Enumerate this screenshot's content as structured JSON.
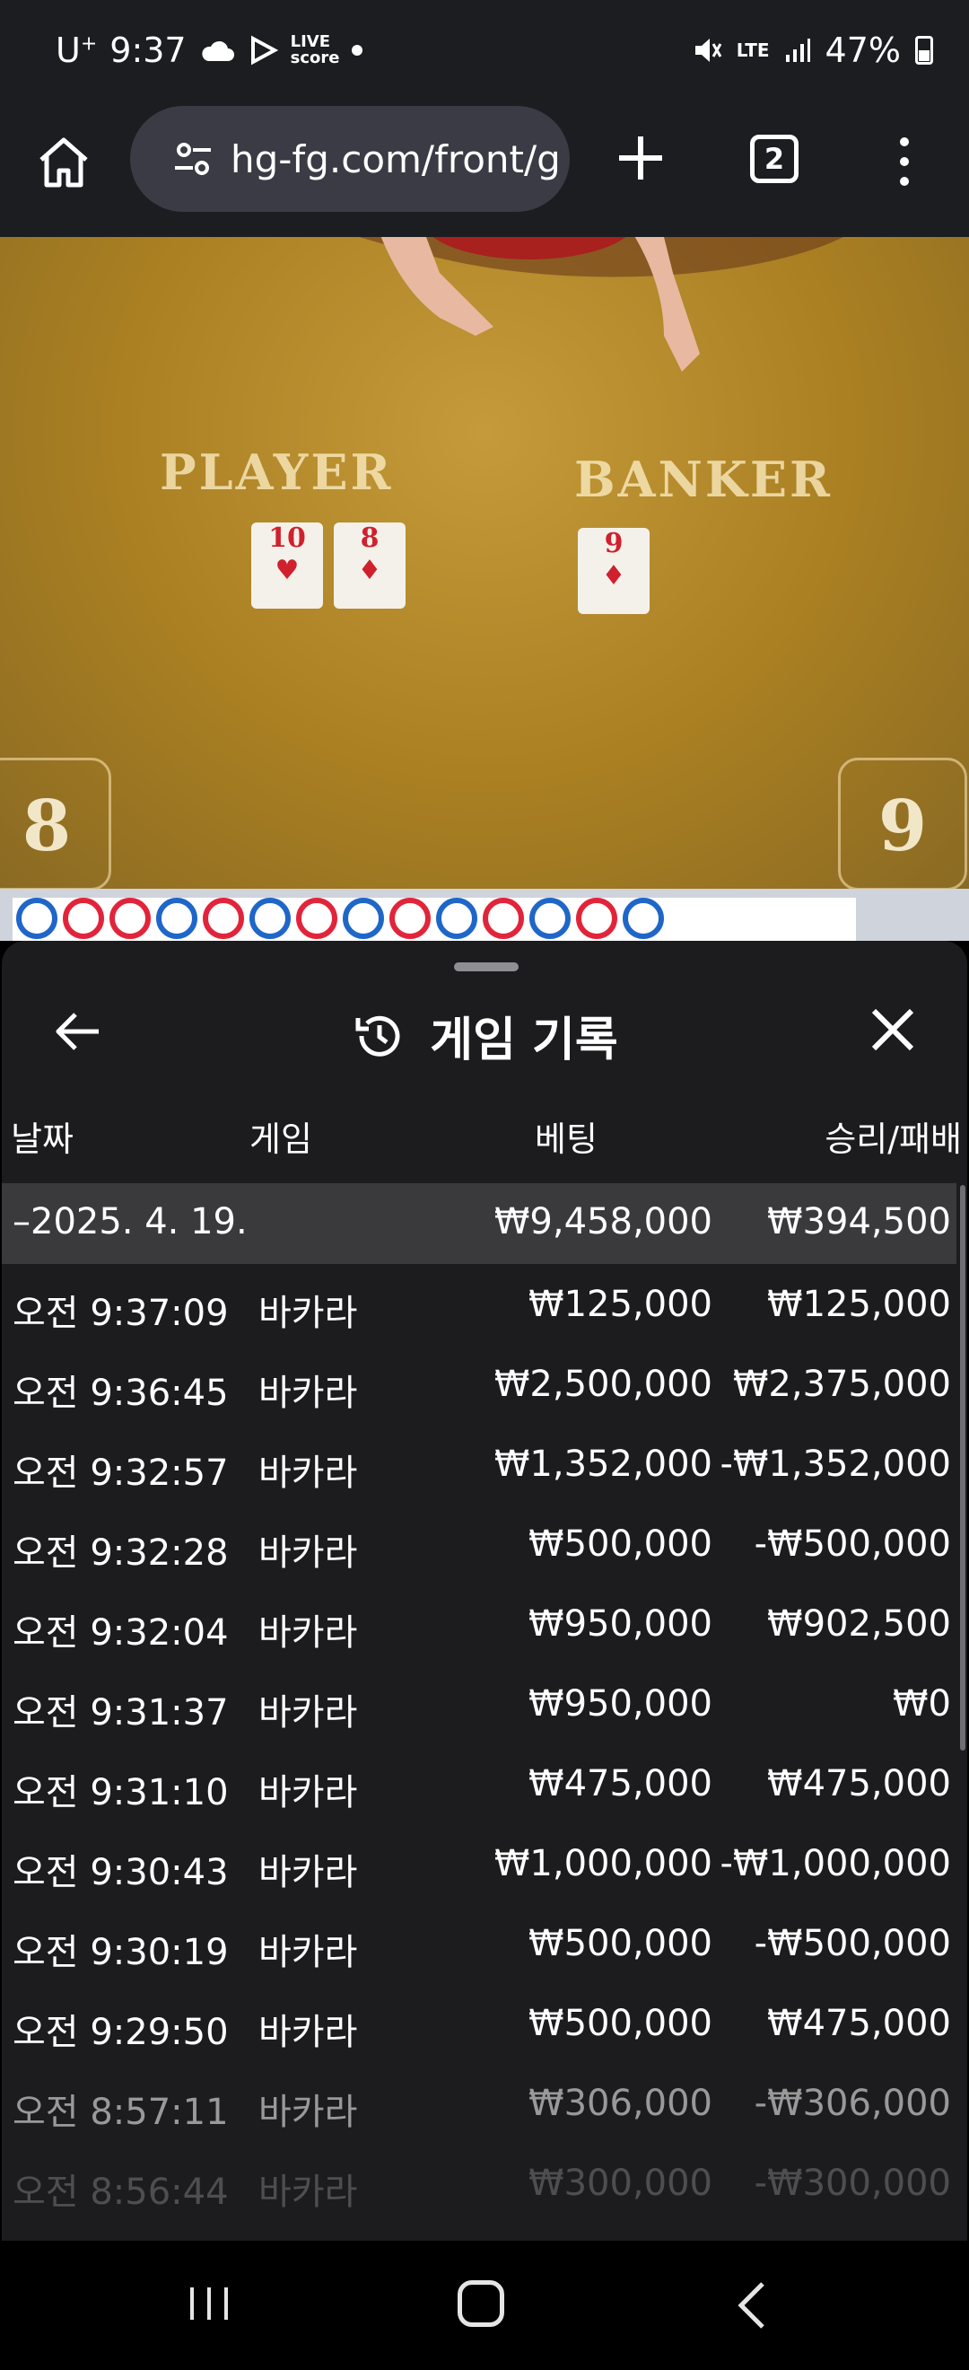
{
  "status_bar": {
    "carrier": "U",
    "carrier_sup": "+",
    "time": "9:37",
    "live_badge_top": "LIVE",
    "live_badge_bottom": "score",
    "network": "LTE",
    "battery": "47%"
  },
  "browser": {
    "url": "hg-fg.com/front/g",
    "tab_count": "2"
  },
  "video": {
    "player_label": "PLAYER",
    "banker_label": "BANKER",
    "player_cards": [
      "10",
      "8"
    ],
    "banker_cards": [
      "9"
    ],
    "player_score": "8",
    "banker_score": "9"
  },
  "road": [
    "P",
    "B",
    "B",
    "P",
    "B",
    "P",
    "B",
    "P",
    "B",
    "P",
    "B",
    "P",
    "B",
    "P"
  ],
  "sheet": {
    "title": "게임 기록",
    "columns": {
      "date": "날짜",
      "game": "게임",
      "bet": "베팅",
      "win": "승리/패배"
    },
    "summary": {
      "date": "–2025. 4. 19.",
      "bet": "₩9,458,000",
      "win": "₩394,500"
    },
    "rows": [
      {
        "time": "오전 9:37:09",
        "game": "바카라",
        "bet": "₩125,000",
        "win": "₩125,000"
      },
      {
        "time": "오전 9:36:45",
        "game": "바카라",
        "bet": "₩2,500,000",
        "win": "₩2,375,000"
      },
      {
        "time": "오전 9:32:57",
        "game": "바카라",
        "bet": "₩1,352,000",
        "win": "-₩1,352,000"
      },
      {
        "time": "오전 9:32:28",
        "game": "바카라",
        "bet": "₩500,000",
        "win": "-₩500,000"
      },
      {
        "time": "오전 9:32:04",
        "game": "바카라",
        "bet": "₩950,000",
        "win": "₩902,500"
      },
      {
        "time": "오전 9:31:37",
        "game": "바카라",
        "bet": "₩950,000",
        "win": "₩0"
      },
      {
        "time": "오전 9:31:10",
        "game": "바카라",
        "bet": "₩475,000",
        "win": "₩475,000"
      },
      {
        "time": "오전 9:30:43",
        "game": "바카라",
        "bet": "₩1,000,000",
        "win": "-₩1,000,000"
      },
      {
        "time": "오전 9:30:19",
        "game": "바카라",
        "bet": "₩500,000",
        "win": "-₩500,000"
      },
      {
        "time": "오전 9:29:50",
        "game": "바카라",
        "bet": "₩500,000",
        "win": "₩475,000"
      },
      {
        "time": "오전 8:57:11",
        "game": "바카라",
        "bet": "₩306,000",
        "win": "-₩306,000"
      },
      {
        "time": "오전 8:56:44",
        "game": "바카라",
        "bet": "₩300,000",
        "win": "-₩300,000"
      }
    ]
  },
  "icons": {
    "home": "home-icon",
    "tune": "tune-icon",
    "plus": "plus-icon",
    "tabs": "tabs-icon",
    "menu": "more-vert-icon",
    "back": "arrow-left-icon",
    "close": "close-icon",
    "history": "history-icon"
  }
}
